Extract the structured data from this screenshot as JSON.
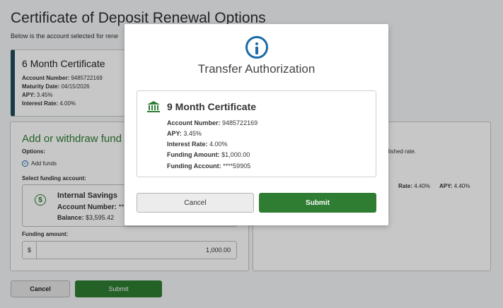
{
  "page": {
    "title": "Certificate of Deposit Renewal Options",
    "subtitle": "Below is the account selected for rene",
    "current_cert": {
      "title": "6 Month Certificate",
      "account_number_label": "Account Number:",
      "account_number": "9485722169",
      "maturity_label": "Maturity Date:",
      "maturity_date": "04/15/2026",
      "apy_label": "APY:",
      "apy": "3.45%",
      "rate_label": "Interest Rate:",
      "rate": "4.00%"
    },
    "funds_panel": {
      "title": "Add or withdraw fund",
      "options_label": "Options:",
      "add_funds_label": "Add funds",
      "select_account_label": "Select funding account:",
      "account": {
        "name": "Internal Savings",
        "number_label": "Account Number:",
        "number_masked": "**",
        "balance_label": "Balance:",
        "balance": "$3,595.42"
      },
      "funding_amount_label": "Funding amount:",
      "currency_symbol": "$",
      "funding_amount": "1,000.00"
    },
    "right_panel": {
      "text": "ublished rate.",
      "rate_label": "Rate:",
      "rate": "4.40%",
      "apy_label": "APY:",
      "apy": "4.40%"
    },
    "buttons": {
      "cancel": "Cancel",
      "submit": "Submit"
    }
  },
  "modal": {
    "title": "Transfer Authorization",
    "icon": "info-icon",
    "cert": {
      "icon": "bank-icon",
      "title": "9 Month Certificate",
      "account_number_label": "Account Number:",
      "account_number": "9485722169",
      "apy_label": "APY:",
      "apy": "3.45%",
      "rate_label": "Interest Rate:",
      "rate": "4.00%",
      "funding_amount_label": "Funding Amount:",
      "funding_amount": "$1,000.00",
      "funding_account_label": "Funding Account:",
      "funding_account": "****59905"
    },
    "cancel_label": "Cancel",
    "submit_label": "Submit"
  },
  "colors": {
    "accent_green": "#2e7d32",
    "info_blue": "#1a6ba8",
    "card_border_dark": "#1f4e5c"
  }
}
